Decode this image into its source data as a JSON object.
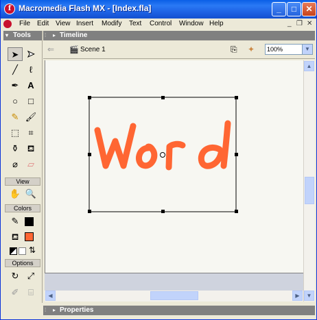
{
  "window": {
    "title": "Macromedia Flash MX - [Index.fla]",
    "app_icon": "flash-icon",
    "controls": [
      "_",
      "□",
      "✕"
    ],
    "doc_controls": [
      "_",
      "❐",
      "✕"
    ]
  },
  "menu": {
    "items": [
      "File",
      "Edit",
      "View",
      "Insert",
      "Modify",
      "Text",
      "Control",
      "Window",
      "Help"
    ]
  },
  "tools_panel": {
    "title": "Tools",
    "view_label": "View",
    "colors_label": "Colors",
    "options_label": "Options",
    "tool_icons": [
      "arrow-icon",
      "subselect-icon",
      "line-icon",
      "lasso-icon",
      "pen-icon",
      "text-icon",
      "oval-icon",
      "rectangle-icon",
      "pencil-icon",
      "brush-icon",
      "free-transform-icon",
      "fill-transform-icon",
      "ink-bottle-icon",
      "paint-bucket-icon",
      "eyedropper-icon",
      "eraser-icon"
    ],
    "stroke_color": "#000000",
    "fill_color": "#ff6633"
  },
  "timeline": {
    "title": "Timeline"
  },
  "edit_bar": {
    "scene": "Scene 1",
    "zoom": "100%"
  },
  "stage": {
    "drawn_text": "Word",
    "drawn_color": "#ff6633"
  },
  "properties": {
    "title": "Properties"
  }
}
